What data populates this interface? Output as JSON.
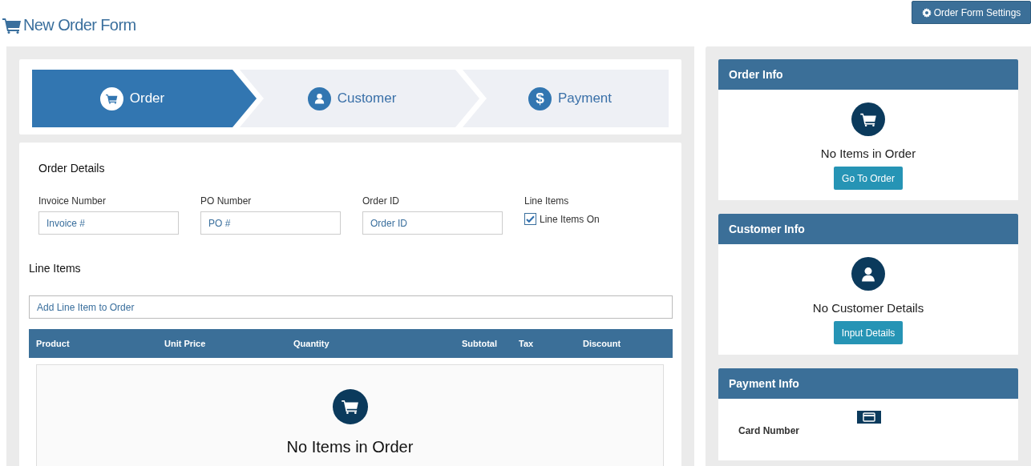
{
  "page": {
    "title": "New Order Form",
    "settings_button": "Order Form Settings"
  },
  "steps": [
    {
      "label": "Order",
      "kind": "cart",
      "selected": true
    },
    {
      "label": "Customer",
      "kind": "user",
      "selected": false
    },
    {
      "label": "Payment",
      "kind": "dollar",
      "icon_text": "$",
      "selected": false
    }
  ],
  "order_details": {
    "heading": "Order Details",
    "fields": [
      {
        "label": "Invoice Number",
        "placeholder": "Invoice #"
      },
      {
        "label": "PO Number",
        "placeholder": "PO #"
      },
      {
        "label": "Order ID",
        "placeholder": "Order ID"
      }
    ],
    "line_items_toggle": {
      "label": "Line Items",
      "option": "Line Items On",
      "checked": true
    }
  },
  "line_items": {
    "heading": "Line Items",
    "add_placeholder": "Add Line Item to Order",
    "columns": [
      "Product",
      "Unit Price",
      "Quantity",
      "Subtotal",
      "Tax",
      "Discount"
    ],
    "empty_message": "No Items in Order"
  },
  "side_cards": [
    {
      "kind": "order",
      "title": "Order Info",
      "message": "No Items in Order",
      "button": "Go To Order"
    },
    {
      "kind": "customer",
      "title": "Customer Info",
      "message": "No Customer Details",
      "button": "Input Details"
    },
    {
      "kind": "payment",
      "title": "Payment Info",
      "field_label": "Card Number"
    }
  ]
}
